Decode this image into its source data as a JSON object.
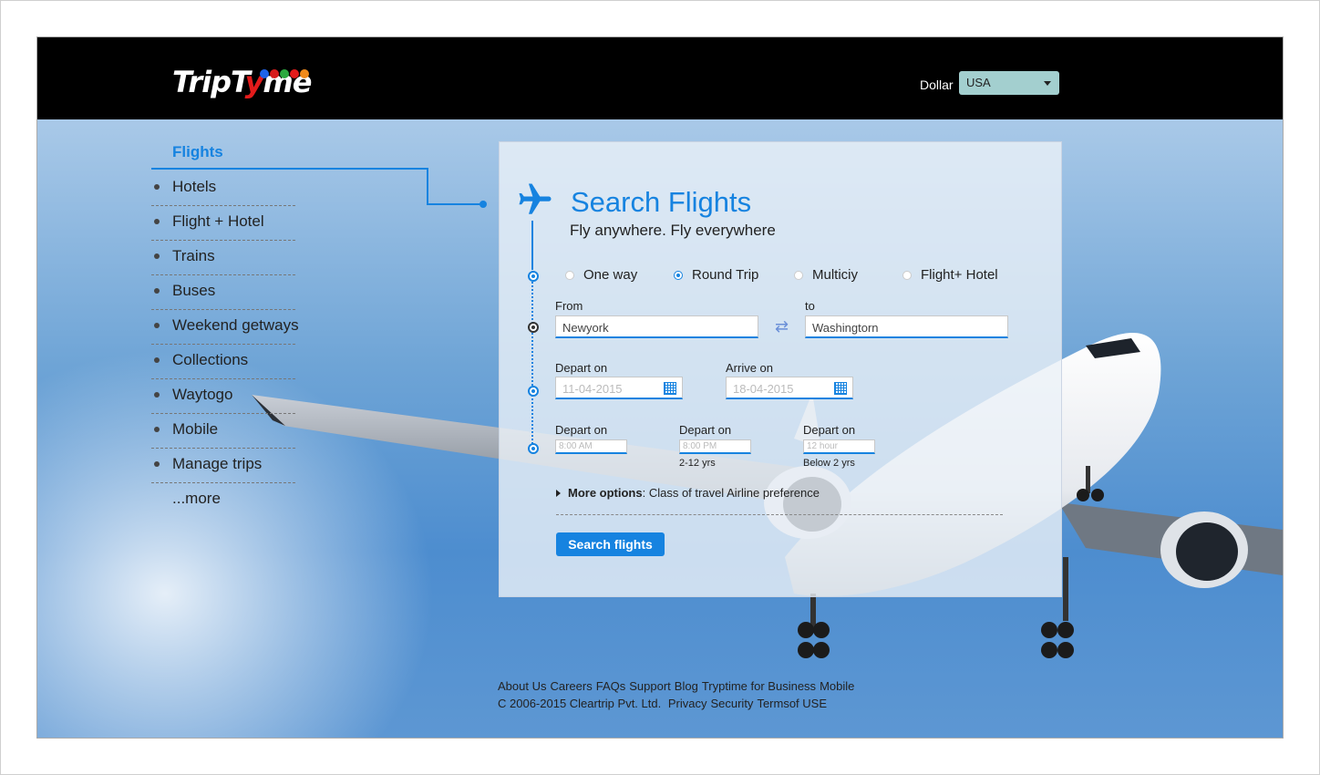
{
  "header": {
    "logo_text_1": "TripT",
    "logo_text_y": "y",
    "logo_text_2": "me",
    "logo_dot_colors": [
      "#1e63e9",
      "#d61b1b",
      "#2aa83e",
      "#e31b1b",
      "#f08a1a"
    ],
    "currency_label": "Dollar",
    "currency_value": "USA"
  },
  "nav": {
    "active": "Flights",
    "items": [
      "Hotels",
      "Flight + Hotel",
      "Trains",
      "Buses",
      "Weekend getways",
      "Collections",
      "Waytogo",
      "Mobile",
      "Manage trips"
    ],
    "more": "...more"
  },
  "search": {
    "title": "Search Flights",
    "subtitle": "Fly anywhere. Fly everywhere",
    "trip_types": [
      {
        "label": "One way",
        "selected": false
      },
      {
        "label": "Round Trip",
        "selected": true
      },
      {
        "label": "Multiciy",
        "selected": false
      },
      {
        "label": "Flight+ Hotel",
        "selected": false
      }
    ],
    "from_label": "From",
    "from_value": "Newyork",
    "to_label": "to",
    "to_value": "Washingtorn",
    "depart_label": "Depart on",
    "depart_value": "11-04-2015",
    "arrive_label": "Arrive on",
    "arrive_value": "18-04-2015",
    "extra": [
      {
        "label": "Depart on",
        "value": "8:00 AM",
        "note": ""
      },
      {
        "label": "Depart on",
        "value": "8:00 PM",
        "note": "2-12 yrs"
      },
      {
        "label": "Depart on",
        "value": "12 hour",
        "note": "Below 2 yrs"
      }
    ],
    "more_options_label": "More options",
    "more_options_text": ": Class of travel Airline preference",
    "button_label": "Search flights"
  },
  "footer": {
    "links": [
      "About Us",
      "Careers",
      "FAQs",
      "Support",
      "Blog",
      "Tryptime for Business",
      "Mobile"
    ],
    "copyright": "C 2006-2015 Cleartrip Pvt. Ltd.",
    "legal": [
      "Privacy",
      "Security",
      "Termsof USE"
    ]
  },
  "colors": {
    "accent": "#1683e0",
    "header_bg": "#000000",
    "select_bg": "#a3cfcf"
  },
  "icons": [
    "airplane-icon",
    "calendar-icon",
    "swap-icon",
    "caret-down-icon"
  ]
}
